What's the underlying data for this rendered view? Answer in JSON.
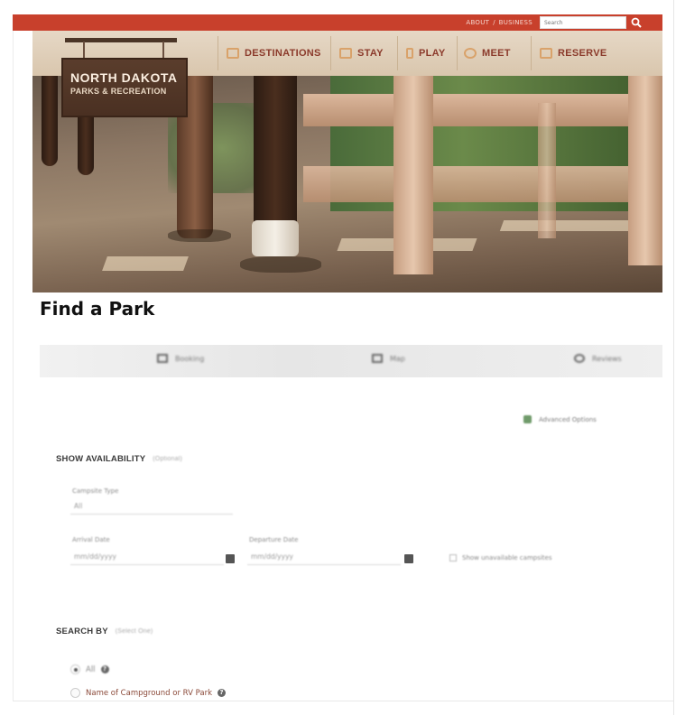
{
  "utility": {
    "about": "ABOUT",
    "separator": "/",
    "business": "BUSINESS",
    "search_placeholder": "Search"
  },
  "nav": {
    "items": [
      {
        "label": "DESTINATIONS",
        "icon": "destinations-icon"
      },
      {
        "label": "STAY",
        "icon": "stay-icon"
      },
      {
        "label": "PLAY",
        "icon": "play-icon"
      },
      {
        "label": "MEET",
        "icon": "meet-icon"
      },
      {
        "label": "RESERVE",
        "icon": "reserve-icon"
      }
    ]
  },
  "brand": {
    "line1": "NORTH DAKOTA",
    "line2": "PARKS & RECREATION"
  },
  "main": {
    "title": "Find a Park",
    "tabs": [
      {
        "label": "Booking",
        "icon": "calendar-icon"
      },
      {
        "label": "Map",
        "icon": "map-icon"
      },
      {
        "label": "Reviews",
        "icon": "chat-icon"
      }
    ],
    "advanced_label": "Advanced Options"
  },
  "availability": {
    "heading": "SHOW AVAILABILITY",
    "sub": "(Optional)",
    "campsite_type_label": "Campsite Type",
    "campsite_type_value": "All",
    "arrival_label": "Arrival Date",
    "arrival_placeholder": "mm/dd/yyyy",
    "departure_label": "Departure Date",
    "departure_placeholder": "mm/dd/yyyy",
    "checkbox_label": "Show unavailable campsites"
  },
  "search_by": {
    "heading": "SEARCH BY",
    "sub": "(Select One)",
    "options": [
      {
        "label": "All",
        "selected": true
      },
      {
        "label": "Name of Campground or RV Park",
        "selected": false
      }
    ]
  },
  "colors": {
    "topbar": "#c8402c",
    "nav_text": "#8b3a2b",
    "accent": "#6f9a6a"
  }
}
